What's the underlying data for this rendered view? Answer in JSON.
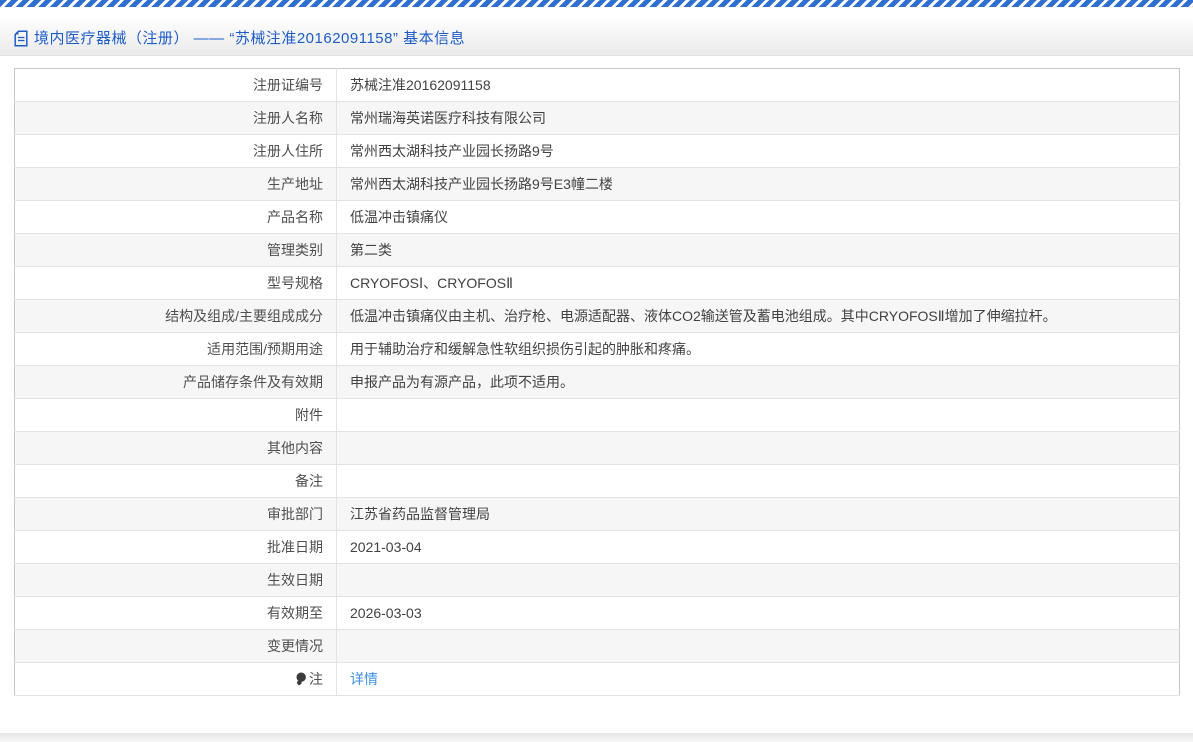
{
  "header": {
    "title": "境内医疗器械（注册） —— “苏械注准20162091158” 基本信息"
  },
  "table": {
    "rows": [
      {
        "label": "注册证编号",
        "value": "苏械注准20162091158"
      },
      {
        "label": "注册人名称",
        "value": "常州瑞海英诺医疗科技有限公司"
      },
      {
        "label": "注册人住所",
        "value": "常州西太湖科技产业园长扬路9号"
      },
      {
        "label": "生产地址",
        "value": "常州西太湖科技产业园长扬路9号E3幢二楼"
      },
      {
        "label": "产品名称",
        "value": "低温冲击镇痛仪"
      },
      {
        "label": "管理类别",
        "value": "第二类"
      },
      {
        "label": "型号规格",
        "value": "CRYOFOSⅠ、CRYOFOSⅡ"
      },
      {
        "label": "结构及组成/主要组成成分",
        "value": "低温冲击镇痛仪由主机、治疗枪、电源适配器、液体CO2输送管及蓄电池组成。其中CRYOFOSⅡ增加了伸缩拉杆。"
      },
      {
        "label": "适用范围/预期用途",
        "value": "用于辅助治疗和缓解急性软组织损伤引起的肿胀和疼痛。"
      },
      {
        "label": "产品储存条件及有效期",
        "value": "申报产品为有源产品，此项不适用。"
      },
      {
        "label": "附件",
        "value": ""
      },
      {
        "label": "其他内容",
        "value": ""
      },
      {
        "label": "备注",
        "value": ""
      },
      {
        "label": "审批部门",
        "value": "江苏省药品监督管理局"
      },
      {
        "label": "批准日期",
        "value": "2021-03-04"
      },
      {
        "label": "生效日期",
        "value": ""
      },
      {
        "label": "有效期至",
        "value": "2026-03-03"
      },
      {
        "label": "变更情况",
        "value": ""
      },
      {
        "label": "注",
        "value": "详情",
        "label_icon": "bulb-icon",
        "value_type": "link"
      }
    ]
  },
  "colors": {
    "title_blue": "#1e5cc8",
    "link_blue": "#3e8fe8",
    "stripe_blue": "#2e6fd0",
    "row_alt_bg": "#f6f6f6"
  }
}
